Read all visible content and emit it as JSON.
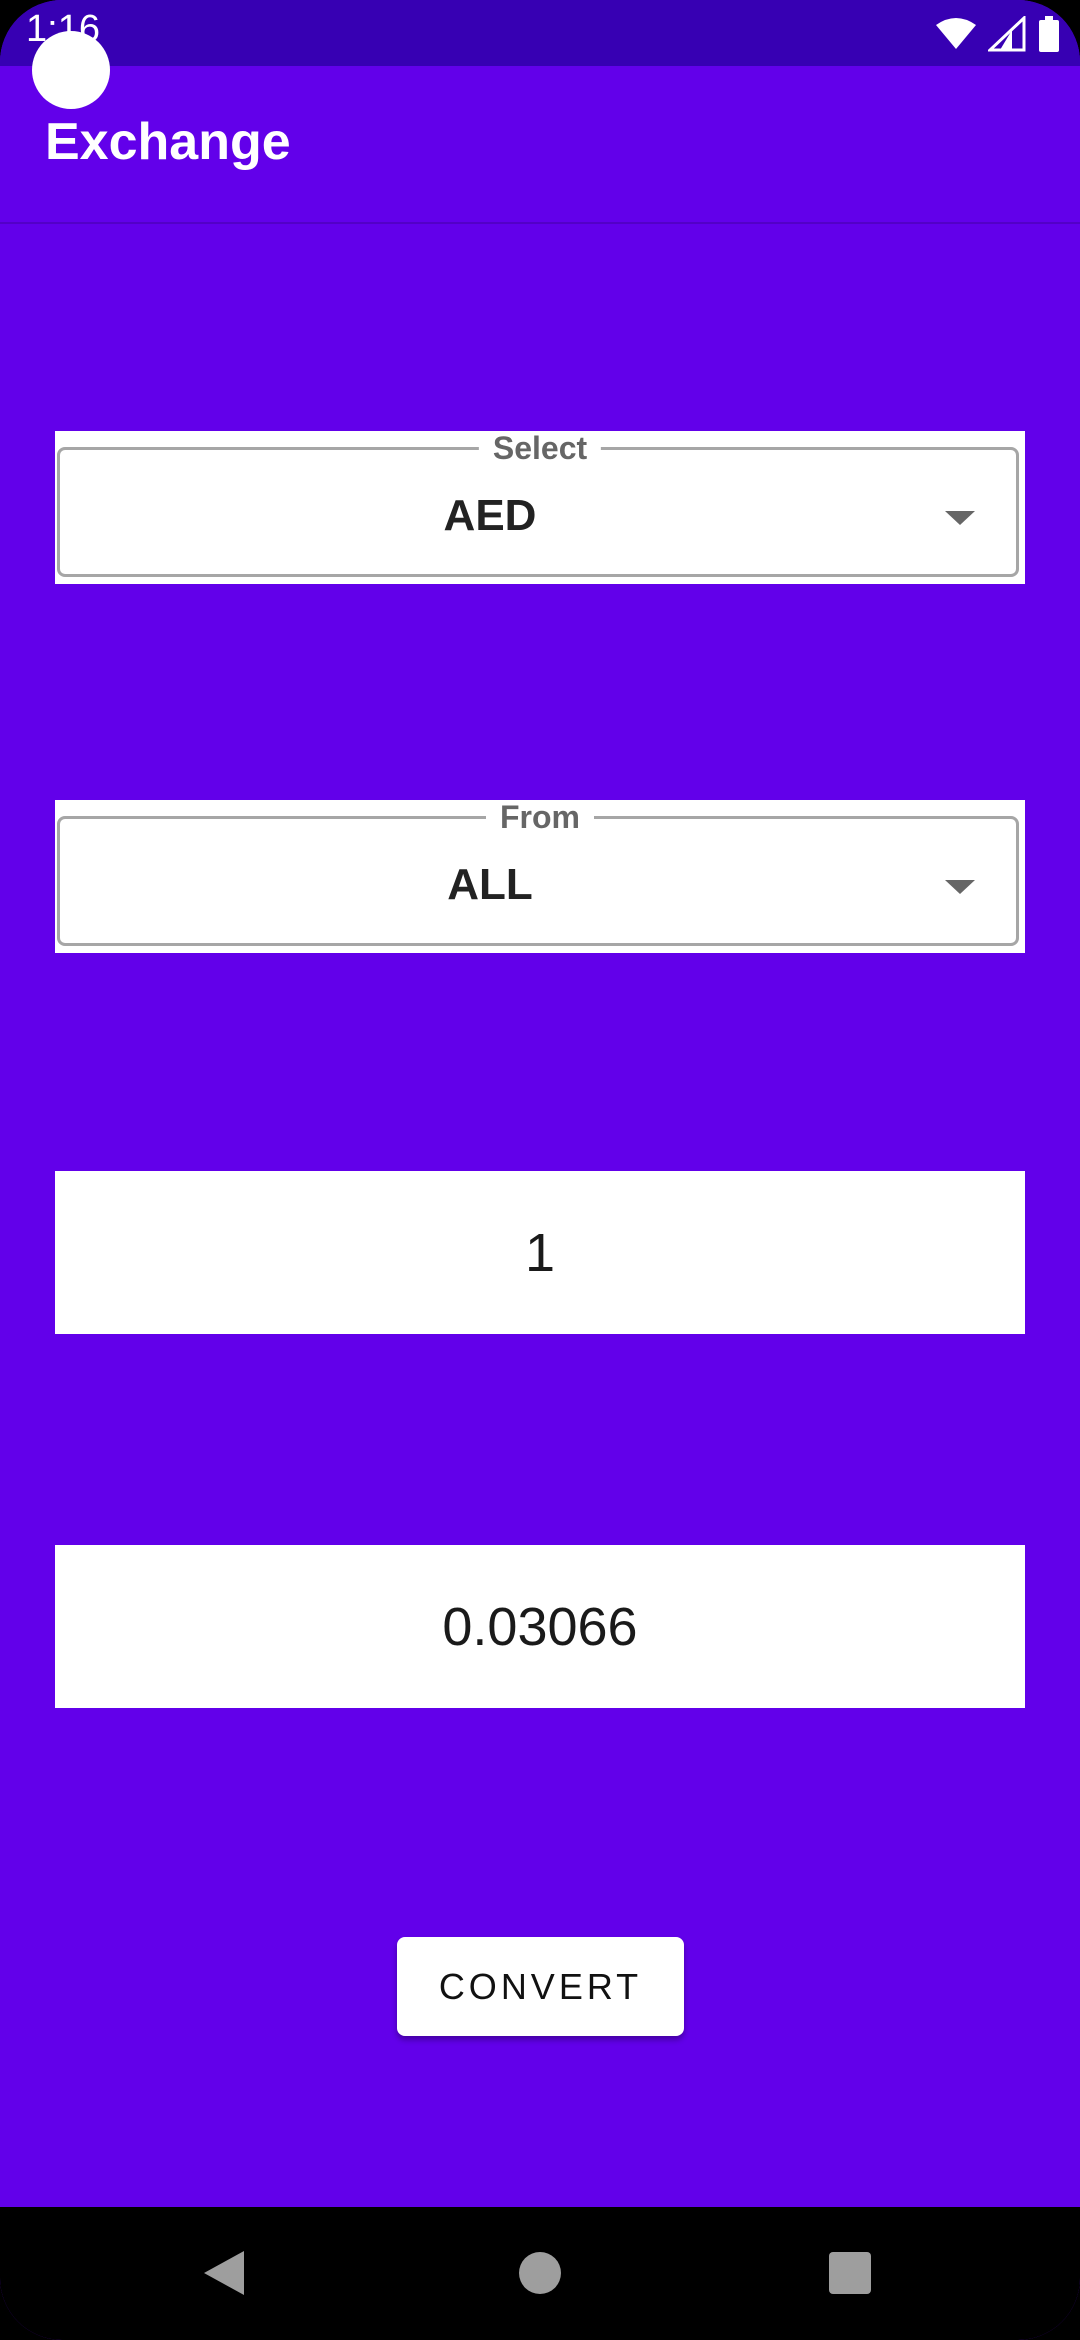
{
  "status_bar": {
    "time": "1:16",
    "wifi_icon": "wifi-icon",
    "signal_icon": "cell-signal-icon",
    "battery_icon": "battery-icon"
  },
  "app_bar": {
    "title": "Exchange"
  },
  "to_spinner": {
    "label": "Select",
    "value": "AED"
  },
  "from_spinner": {
    "label": "From",
    "value": "ALL"
  },
  "amount_input": {
    "value": "1"
  },
  "result_output": {
    "value": "0.03066"
  },
  "convert_button": {
    "label": "CONVERT"
  },
  "nav_bar": {
    "back_icon": "back-triangle-icon",
    "home_icon": "home-circle-icon",
    "recents_icon": "recents-square-icon"
  },
  "colors": {
    "primary": "#6200ea",
    "primary_dark": "#3700b3",
    "surface": "#ffffff"
  }
}
